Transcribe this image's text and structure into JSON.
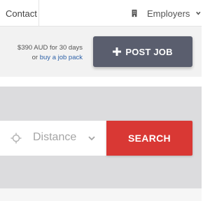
{
  "nav": {
    "contact_label": "Contact",
    "employers_label": "Employers",
    "employers_icon": "building-icon",
    "employers_chevron": "chevron-down-icon"
  },
  "post_job": {
    "price_line1": "$390 AUD for 30 days",
    "price_line2_prefix": "or",
    "price_line2_link": "buy a job pack",
    "button_label": "POST JOB",
    "button_icon": "plus-icon",
    "button_color": "#5a5e6e"
  },
  "search": {
    "distance_icon": "crosshair-icon",
    "distance_label": "Distance",
    "distance_chevron": "chevron-down-icon",
    "button_label": "SEARCH",
    "button_color": "#d93834"
  }
}
